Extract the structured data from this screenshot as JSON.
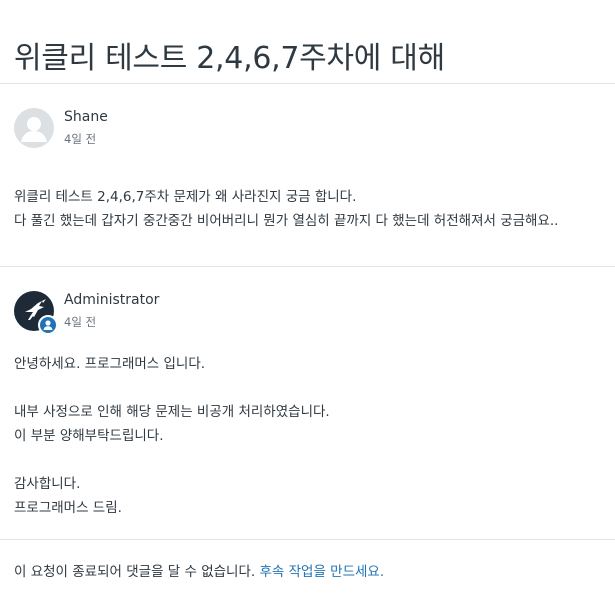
{
  "page": {
    "title": "위클리 테스트 2,4,6,7주차에 대해"
  },
  "post": {
    "author": "Shane",
    "time": "4일 전",
    "avatar_icon": "default-user-avatar-icon",
    "lines": [
      "위클리 테스트 2,4,6,7주차 문제가 왜 사라진지 궁금 합니다.",
      "다 풀긴 했는데 갑자기 중간중간 비어버리니 뭔가 열심히 끝까지 다 했는데 허전해져서 궁금해요.."
    ]
  },
  "reply": {
    "author": "Administrator",
    "time": "4일 전",
    "avatar_icon": "hummingbird-logo-icon",
    "badge_icon": "agent-badge-icon",
    "greeting": "안녕하세요. 프로그래머스 입니다.",
    "line1": "내부 사정으로 인해 해당 문제는 비공개 처리하였습니다.",
    "line2": "이 부분 양해부탁드립니다.",
    "closing1": "감사합니다.",
    "closing2": "프로그래머스 드림."
  },
  "footer": {
    "closed_text": "이 요청이 종료되어 댓글을 달 수 없습니다. ",
    "followup_link": "후속 작업을 만드세요."
  },
  "colors": {
    "text": "#2f3941",
    "muted": "#68737d",
    "link": "#1f73b7",
    "divider": "#e2e5e8",
    "admin_avatar_bg": "#1f2a38"
  }
}
